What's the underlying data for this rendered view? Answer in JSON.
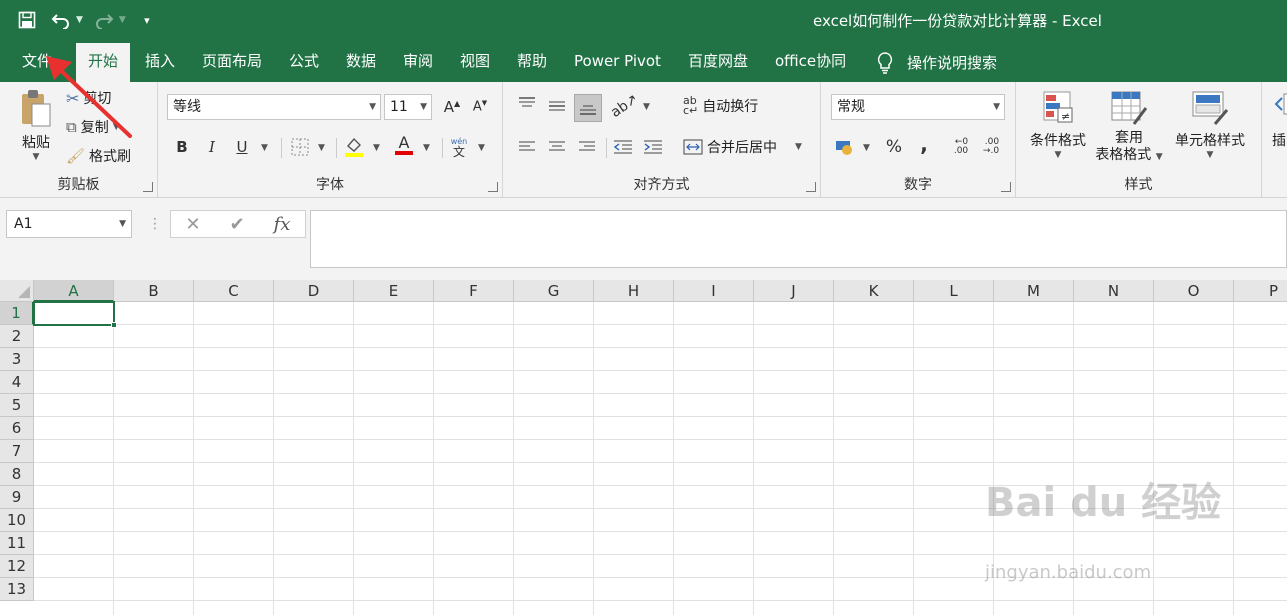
{
  "window": {
    "title": "excel如何制作一份贷款对比计算器  -  Excel"
  },
  "tabs": [
    {
      "label": "文件"
    },
    {
      "label": "开始",
      "active": true
    },
    {
      "label": "插入"
    },
    {
      "label": "页面布局"
    },
    {
      "label": "公式"
    },
    {
      "label": "数据"
    },
    {
      "label": "审阅"
    },
    {
      "label": "视图"
    },
    {
      "label": "帮助"
    },
    {
      "label": "Power Pivot"
    },
    {
      "label": "百度网盘"
    },
    {
      "label": "office协同"
    }
  ],
  "tell_me": "操作说明搜索",
  "ribbon": {
    "clipboard": {
      "group_label": "剪贴板",
      "paste": "粘贴",
      "cut": "剪切",
      "copy": "复制",
      "format_painter": "格式刷"
    },
    "font": {
      "group_label": "字体",
      "font_name": "等线",
      "font_size": "11",
      "bold": "B",
      "italic": "I",
      "underline": "U",
      "font_color_letter": "A",
      "phonetic": "wén",
      "phonetic_char": "文"
    },
    "alignment": {
      "group_label": "对齐方式",
      "wrap_text": "自动换行",
      "merge_center": "合并后居中"
    },
    "number": {
      "group_label": "数字",
      "format": "常规",
      "percent": "%",
      "comma": ","
    },
    "styles": {
      "group_label": "样式",
      "conditional": "条件格式",
      "table_line1": "套用",
      "table_line2": "表格格式",
      "cell_styles": "单元格样式"
    },
    "cells_partial": "插"
  },
  "formula_bar": {
    "name_box": "A1",
    "cancel": "✕",
    "enter": "✔",
    "fx": "fx",
    "content": ""
  },
  "grid": {
    "columns": [
      "A",
      "B",
      "C",
      "D",
      "E",
      "F",
      "G",
      "H",
      "I",
      "J",
      "K",
      "L",
      "M",
      "N",
      "O",
      "P"
    ],
    "rows": [
      "1",
      "2",
      "3",
      "4",
      "5",
      "6",
      "7",
      "8",
      "9",
      "10",
      "11",
      "12",
      "13"
    ],
    "selected_cell": "A1"
  },
  "colors": {
    "accent": "#217346",
    "annotation": "#e8302f"
  },
  "watermark": {
    "logo": "Bai du 经验",
    "url": "jingyan.baidu.com"
  }
}
